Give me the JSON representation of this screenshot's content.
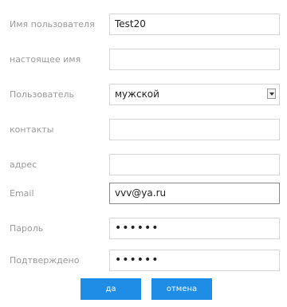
{
  "fields": [
    {
      "label": "Имя пользователя",
      "value": "Test20"
    },
    {
      "label": "настоящее имя",
      "value": ""
    },
    {
      "label": "Пользователь",
      "value": "мужской"
    },
    {
      "label": "контакты",
      "value": ""
    },
    {
      "label": "адрес",
      "value": ""
    },
    {
      "label": "Email",
      "value": "vvv@ya.ru"
    },
    {
      "label": "Пароль",
      "value": "••••••"
    },
    {
      "label": "Подтверждено",
      "value": "••••••"
    }
  ],
  "buttons": {
    "ok": "да",
    "cancel": "отмена"
  },
  "colors": {
    "accent": "#1f8de6",
    "label": "#9a9a9a",
    "border": "#d6d6d6"
  },
  "icons": {
    "select": "chevron-down-icon"
  }
}
